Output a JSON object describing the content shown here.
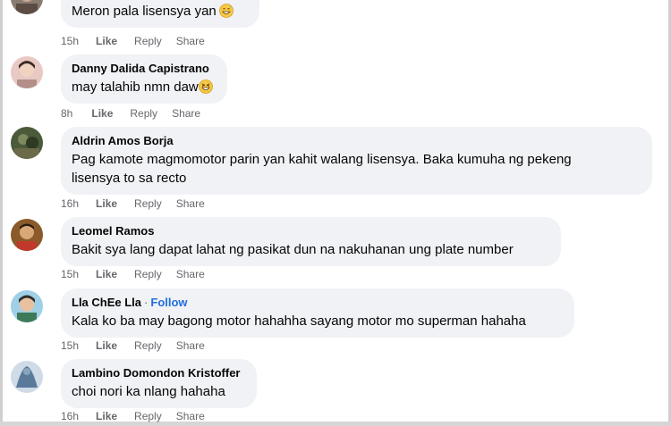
{
  "comments": [
    {
      "author": "",
      "text": "Meron pala lisensya yan",
      "emoji": "grinning-sweat-emoji",
      "time": "15h",
      "like": "Like",
      "reply": "Reply",
      "share": "Share",
      "avatar_color": "#8a7b70"
    },
    {
      "author": "Danny Dalida Capistrano",
      "text": "may talahib nmn daw",
      "emoji": "grinning-squinting-emoji",
      "time": "8h",
      "like": "Like",
      "reply": "Reply",
      "share": "Share",
      "avatar_color": "#e8c9c4"
    },
    {
      "author": "Aldrin Amos Borja",
      "text_line1": "Pag kamote magmomotor parin yan kahit walang lisensya. Baka kumuha ng pekeng",
      "text_line2": "lisensya to sa recto",
      "time": "16h",
      "like": "Like",
      "reply": "Reply",
      "share": "Share",
      "avatar_color": "#4a5a3a"
    },
    {
      "author": "Leomel Ramos",
      "text": "Bakit sya lang dapat lahat ng pasikat dun na nakuhanan ung plate number",
      "time": "15h",
      "like": "Like",
      "reply": "Reply",
      "share": "Share",
      "avatar_color": "#c0392b"
    },
    {
      "author": "Lla ChEe Lla",
      "follow_sep": "·",
      "follow": "Follow",
      "text": "Kala ko ba may bagong motor hahahha sayang motor mo superman hahaha",
      "time": "15h",
      "like": "Like",
      "reply": "Reply",
      "share": "Share",
      "avatar_color": "#6fa8c7"
    },
    {
      "author": "Lambino Domondon Kristoffer",
      "text": "choi nori ka nlang hahaha",
      "time": "16h",
      "like": "Like",
      "reply": "Reply",
      "share": "Share",
      "avatar_color": "#5a7a9a"
    }
  ],
  "colors": {
    "bubble": "#f0f2f5",
    "meta": "#65676b",
    "follow": "#216fdb",
    "text": "#050505"
  }
}
